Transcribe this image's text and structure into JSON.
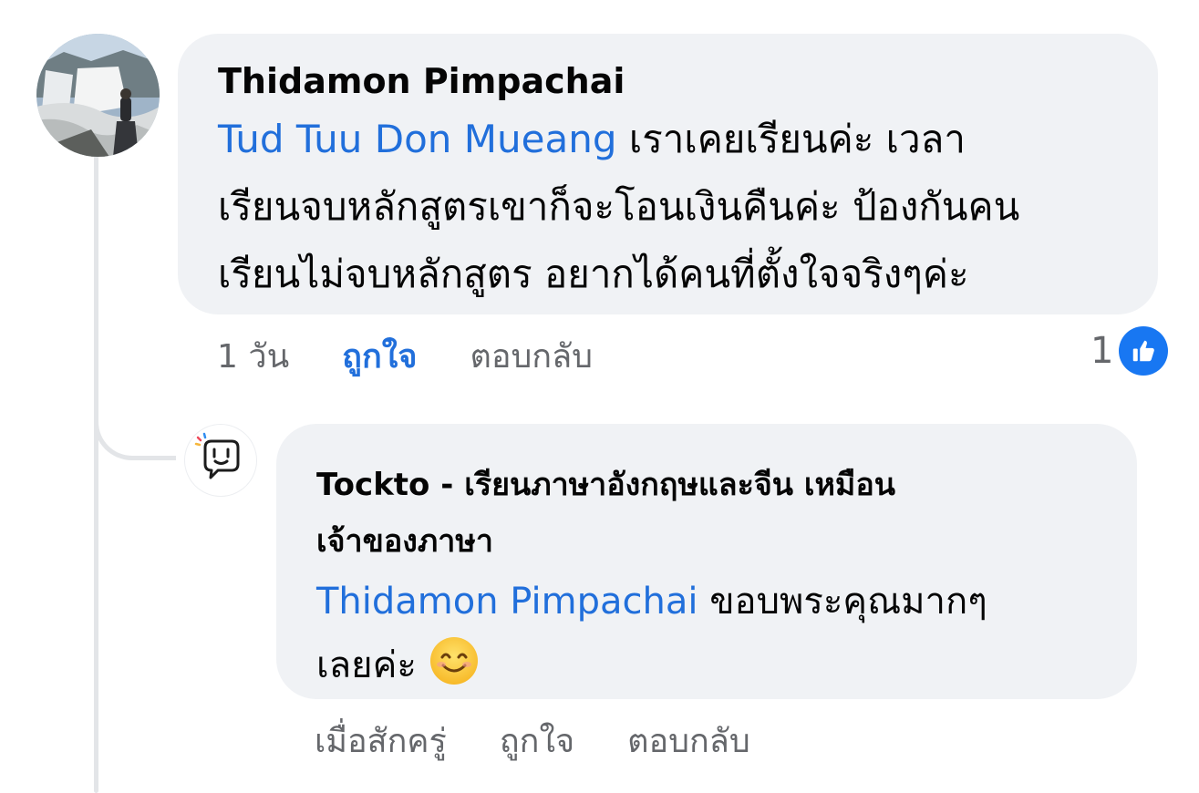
{
  "thread": {
    "main_comment": {
      "author": "Thidamon Pimpachai",
      "mention": "Tud Tuu Don Mueang",
      "line1_rest": " เราเคยเรียนค่ะ เวลา",
      "line2": "เรียนจบหลักสูตรเขาก็จะโอนเงินคืนค่ะ ป้องกันคน",
      "line3": "เรียนไม่จบหลักสูตร อยากได้คนที่ตั้งใจจริงๆค่ะ",
      "time": "1 วัน",
      "like_label": "ถูกใจ",
      "reply_label": "ตอบกลับ",
      "like_count": "1"
    },
    "reply_comment": {
      "author_line1": "Tockto -  เรียนภาษาอังกฤษและจีน เหมือน",
      "author_line2": "เจ้าของภาษา",
      "mention": "Thidamon Pimpachai",
      "line1_rest": " ขอบพระคุณมากๆ",
      "line2": "เลยค่ะ ",
      "emoji": "smiling-face-emoji",
      "time": "เมื่อสักครู่",
      "like_label": "ถูกใจ",
      "reply_label": "ตอบกลับ"
    }
  },
  "colors": {
    "bubble": "#f0f2f5",
    "mention": "#216fdb",
    "meta": "#65676b",
    "like_badge": "#1877f2"
  }
}
